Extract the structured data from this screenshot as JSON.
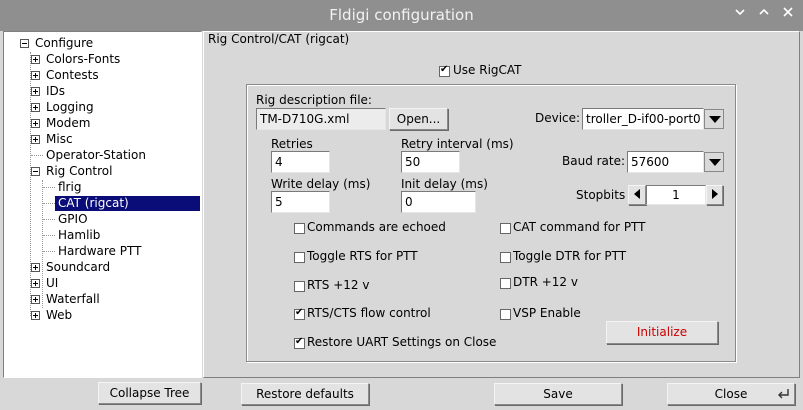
{
  "window": {
    "title": "Fldigi configuration",
    "controls": [
      "chevron-down-icon",
      "chevron-up-icon",
      "close-icon"
    ]
  },
  "tree": {
    "root": "Configure",
    "items": [
      {
        "label": "Colors-Fonts",
        "expandable": true
      },
      {
        "label": "Contests",
        "expandable": true
      },
      {
        "label": "IDs",
        "expandable": true
      },
      {
        "label": "Logging",
        "expandable": true
      },
      {
        "label": "Modem",
        "expandable": true
      },
      {
        "label": "Misc",
        "expandable": true
      },
      {
        "label": "Operator-Station",
        "expandable": false
      },
      {
        "label": "Rig Control",
        "expandable": true,
        "expanded": true
      },
      {
        "label": "flrig",
        "child": true
      },
      {
        "label": "CAT (rigcat)",
        "child": true,
        "selected": true
      },
      {
        "label": "GPIO",
        "child": true
      },
      {
        "label": "Hamlib",
        "child": true
      },
      {
        "label": "Hardware PTT",
        "child": true
      },
      {
        "label": "Soundcard",
        "expandable": true
      },
      {
        "label": "UI",
        "expandable": true
      },
      {
        "label": "Waterfall",
        "expandable": true
      },
      {
        "label": "Web",
        "expandable": true
      }
    ]
  },
  "panel": {
    "heading": "Rig Control/CAT (rigcat)",
    "use_rigcat": {
      "label": "Use RigCAT",
      "checked": true
    },
    "rig_description": {
      "label": "Rig description file:",
      "value": "TM-D710G.xml",
      "open_button": "Open..."
    },
    "device": {
      "label": "Device:",
      "value": "troller_D-if00-port0"
    },
    "retries": {
      "label": "Retries",
      "value": "4"
    },
    "retry_interval": {
      "label": "Retry interval (ms)",
      "value": "50"
    },
    "write_delay": {
      "label": "Write delay (ms)",
      "value": "5"
    },
    "init_delay": {
      "label": "Init delay (ms)",
      "value": "0"
    },
    "baud_rate": {
      "label": "Baud rate:",
      "value": "57600"
    },
    "stopbits": {
      "label": "Stopbits",
      "value": "1"
    },
    "checkboxes": {
      "commands_echoed": {
        "label": "Commands are echoed",
        "checked": false
      },
      "cat_ptt": {
        "label": "CAT command for PTT",
        "checked": false
      },
      "toggle_rts": {
        "label": "Toggle RTS for PTT",
        "checked": false
      },
      "toggle_dtr": {
        "label": "Toggle DTR for PTT",
        "checked": false
      },
      "rts_12v": {
        "label": "RTS +12 v",
        "checked": false
      },
      "dtr_12v": {
        "label": "DTR +12 v",
        "checked": false
      },
      "rts_cts": {
        "label": "RTS/CTS flow control",
        "checked": true
      },
      "vsp": {
        "label": "VSP Enable",
        "checked": false
      },
      "restore_uart": {
        "label": "Restore UART Settings on Close",
        "checked": true
      }
    },
    "initialize_button": "Initialize",
    "initialize_color": "#cc0000"
  },
  "bottom": {
    "collapse_tree": "Collapse Tree",
    "restore_defaults": "Restore defaults",
    "save": "Save",
    "close": "Close"
  }
}
